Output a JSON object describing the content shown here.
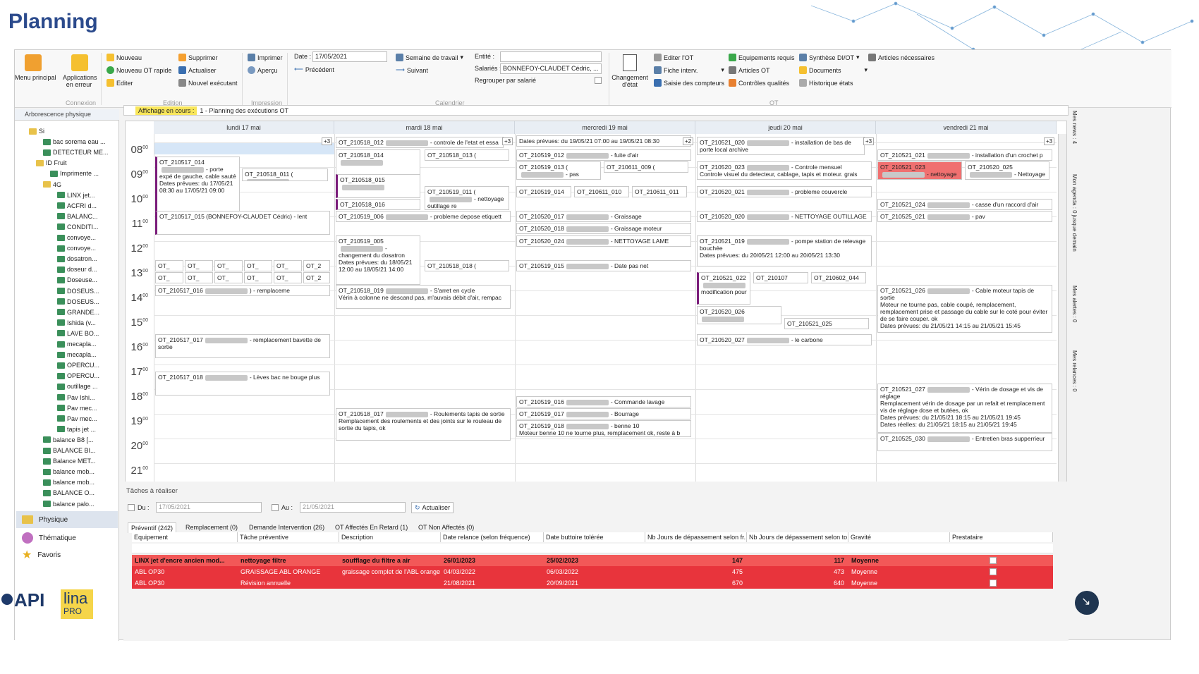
{
  "page_title": "Planning",
  "ribbon": {
    "menu_principal": "Menu principal",
    "applications": "Applications en erreur",
    "connexion": "Connexion",
    "nouveau": "Nouveau",
    "nouveau_ot_rapide": "Nouveau OT rapide",
    "editer": "Editer",
    "supprimer": "Supprimer",
    "actualiser": "Actualiser",
    "nouvel_executant": "Nouvel exécutant",
    "edition": "Edition",
    "imprimer": "Imprimer",
    "apercu": "Aperçu",
    "impression": "Impression",
    "date_label": "Date :",
    "date_value": "17/05/2021",
    "precedent": "Précédent",
    "semaine": "Semaine de travail",
    "suivant": "Suivant",
    "calendrier": "Calendrier",
    "entite_label": "Entité :",
    "salaries_label": "Salariés :",
    "salaries_value": "BONNEFOY-CLAUDET Cédric, ...",
    "regrouper": "Regrouper par salarié",
    "changement_etat": "Changement d'état",
    "editer_ot": "Editer l'OT",
    "fiche_interv": "Fiche interv.",
    "saisie_compteurs": "Saisie des compteurs",
    "equipements_requis": "Equipements requis",
    "articles_ot": "Articles OT",
    "controles_qualites": "Contrôles qualités",
    "synthese": "Synthèse DI/OT",
    "documents": "Documents",
    "historique": "Historique états",
    "articles_necessaires": "Articles nécessaires",
    "ot_group": "OT"
  },
  "left": {
    "header": "Arborescence physique",
    "items": [
      "Si",
      "bac sorema eau ...",
      "DETECTEUR ME...",
      "ID Fruit",
      "Imprimente ...",
      "4G",
      "LINX jet...",
      "ACFRI d...",
      "BALANC...",
      "CONDITI...",
      "convoye...",
      "convoye...",
      "dosatron...",
      "doseur d...",
      "Doseuse...",
      "DOSEUS...",
      "DOSEUS...",
      "GRANDE...",
      "Ishida (v...",
      "LAVE BO...",
      "mecapla...",
      "mecapla...",
      "OPERCU...",
      "OPERCU...",
      "outillage ...",
      "Pav Ishi...",
      "Pav mec...",
      "Pav mec...",
      "tapis jet ...",
      "balance B8 [...",
      "BALANCE BI...",
      "Balance MET...",
      "balance mob...",
      "balance mob...",
      "BALANCE O...",
      "balance palo..."
    ],
    "nav": [
      "Physique",
      "Thématique",
      "Favoris"
    ]
  },
  "planning": {
    "affichage": "Affichage en cours :",
    "vue": "1 - Planning des exécutions OT",
    "days": [
      "lundi 17 mai",
      "mardi 18 mai",
      "mercredi 19 mai",
      "jeudi 20 mai",
      "vendredi 21 mai"
    ],
    "hours": [
      "08",
      "09",
      "10",
      "11",
      "12",
      "13",
      "14",
      "15",
      "16",
      "17",
      "18",
      "19",
      "20",
      "21"
    ],
    "minutes": "00"
  },
  "events": {
    "e1": "OT_210517_014",
    "e1b": "- porte expé de gauche, cable sauté",
    "e1c": "Dates prévues: du 17/05/21 08:30 au 17/05/21 09:00",
    "e2": "OT_210518_011 (",
    "e3": "OT_210517_015 (BONNEFOY-CLAUDET Cédric) - lent",
    "e4": "OT_",
    "e4b": "OT_2",
    "e5": "OT_210517_016",
    "e5b": ") - remplaceme",
    "e6": "OT_210517_017",
    "e6b": "- remplacement bavette de sortie",
    "e7": "OT_210517_018",
    "e7b": "- Lèves bac ne bouge plus",
    "m1": "OT_210518_012",
    "m1b": "- controle de l'etat et essa",
    "m2": "OT_210518_014",
    "m3": "OT_210518_013 (",
    "m4": "OT_210518_015",
    "m5": "OT_210518_016",
    "m6": "OT_210519_011 (",
    "m6b": "- nettoyage outillage re",
    "m7": "OT_210519_006",
    "m7b": "- probleme depose etiquett",
    "m8": "OT_210519_005",
    "m8b": "- changement du dosatron",
    "m9": "Dates prévues: du 18/05/21 12:00 au 18/05/21 14:00",
    "m10": "OT_210518_018 (",
    "m11": "OT_210518_019",
    "m11b": "- S'arret en cycle",
    "m11c": "Vérin à colonne ne descand pas, m'auvais débit d'air, rempac",
    "m12": "OT_210518_017",
    "m12b": "- Roulements tapis de sortie",
    "m12c": "Remplacement des roulements et des joints sur le rouleau de sortie du tapis, ok",
    "w1": "Dates prévues: du 19/05/21 07:00 au 19/05/21 08:30",
    "w2": "OT_210519_012",
    "w2b": "- fuite d'air",
    "w3": "OT_210519_013 (",
    "w3b": "- pas d'éjection",
    "w4": "OT_210611_009 (",
    "w5": "OT_210519_014",
    "w6": "OT_210611_010",
    "w7": "OT_210611_011",
    "w8": "OT_210520_017",
    "w8b": "- Graissage",
    "w9": "OT_210520_018",
    "w9b": "- Graissage moteur",
    "w10": "OT_210520_024",
    "w10b": "- NETTOYAGE LAME",
    "w11": "OT_210519_015",
    "w11b": "- Date pas net",
    "w12": "OT_210519_016",
    "w12b": "- Commande lavage",
    "w13": "OT_210519_017",
    "w13b": "- Bourrage",
    "w14": "OT_210519_018",
    "w14b": "- benne 10",
    "w14c": "Moteur benne 10 ne tourne plus, remplacement ok, reste à b",
    "j1": "OT_210521_020",
    "j1b": "- installation de bas de porte local archive",
    "j2": "OT_210520_023",
    "j2b": "- Controle mensuel",
    "j2c": "Controle visuel du detecteur, cablage, tapis et moteur. grais",
    "j3": "OT_210520_021",
    "j3b": "- probleme couvercle",
    "j4": "OT_210520_020",
    "j4b": "- NETTOYAGE OUTILLAGE",
    "j5": "OT_210521_019",
    "j5b": "- pompe station de relevage bouchée",
    "j5c": "Dates prévues: du 20/05/21 12:00 au 20/05/21 13:30",
    "j6": "OT_210521_022",
    "j6b": "modification pour",
    "j7": "OT_210107",
    "j8": "OT_210602_044",
    "j9": "OT_210520_026",
    "j10": "OT_210521_025",
    "j11": "OT_210520_027",
    "j11b": "- le carbone",
    "v1": "OT_210521_021",
    "v1b": "- installation d'un crochet p",
    "v2": "OT_210521_023",
    "v2b": "- nettoyage outillage",
    "v3": "OT_210520_025",
    "v3b": "- Nettoyage",
    "v4": "OT_210521_024",
    "v4b": "- casse d'un raccord d'air",
    "v5": "OT_210525_021",
    "v5b": "- pav",
    "v6": "OT_210521_026",
    "v6b": "- Cable moteur tapis de sortie",
    "v6c": "Moteur ne tourne pas, cable coupé, remplacement, remplacement prise et passage du cable sur le coté pour éviter de se faire couper. ok",
    "v6d": "Dates prévues: du 21/05/21 14:15 au 21/05/21 15:45",
    "v7": "OT_210521_027",
    "v7b": "- Vérin de dosage et vis de réglage",
    "v7c": "Remplacement vérin de dosage par un refait et remplacement vis de réglage dose et butées, ok",
    "v7d": "Dates prévues: du 21/05/21 18:15 au 21/05/21 19:45",
    "v7e": "Dates réelles: du 21/05/21 18:15 au 21/05/21 19:45",
    "v8": "OT_210525_030",
    "v8b": "- Entretien bras supperrieur",
    "plus3": "+3",
    "plus2": "+2"
  },
  "bottom": {
    "title": "Tâches à réaliser",
    "du": "Du :",
    "du_value": "17/05/2021",
    "au": "Au :",
    "au_value": "21/05/2021",
    "actualiser": "Actualiser",
    "tabs": [
      "Préventif (242)",
      "Remplacement (0)",
      "Demande Intervention (26)",
      "OT Affectés En Retard (1)",
      "OT Non Affectés (0)"
    ],
    "columns": [
      "Equipement",
      "Tâche préventive",
      "Description",
      "Date relance (selon fréquence)",
      "Date buttoire tolérée",
      "Nb Jours de dépassement selon fr...",
      "Nb Jours de dépassement selon to...",
      "Gravité",
      "Prestataire"
    ],
    "rows": [
      [
        "LINX jet d'encre ancien mod...",
        "nettoyage filtre",
        "soufflage du filtre a air",
        "26/01/2023",
        "25/02/2023",
        "147",
        "117",
        "Moyenne"
      ],
      [
        "ABL OP30",
        "GRAISSAGE ABL ORANGE",
        "graissage complet de l'ABL orange",
        "04/03/2022",
        "06/03/2022",
        "475",
        "473",
        "Moyenne"
      ],
      [
        "ABL OP30",
        "Révision annuelle",
        "",
        "21/08/2021",
        "20/09/2021",
        "670",
        "640",
        "Moyenne"
      ]
    ]
  },
  "right_tabs": [
    "Mes news : 4",
    "Mon agenda : 0 jusque demain",
    "Mes alertes : 0",
    "Mes relances : 0"
  ],
  "logo": {
    "api": "API",
    "lina": "lina",
    "pro": "PRO"
  },
  "colors": {
    "title": "#2b4a8c",
    "row_red": "#e8343c",
    "highlight": "#f8e65a"
  }
}
